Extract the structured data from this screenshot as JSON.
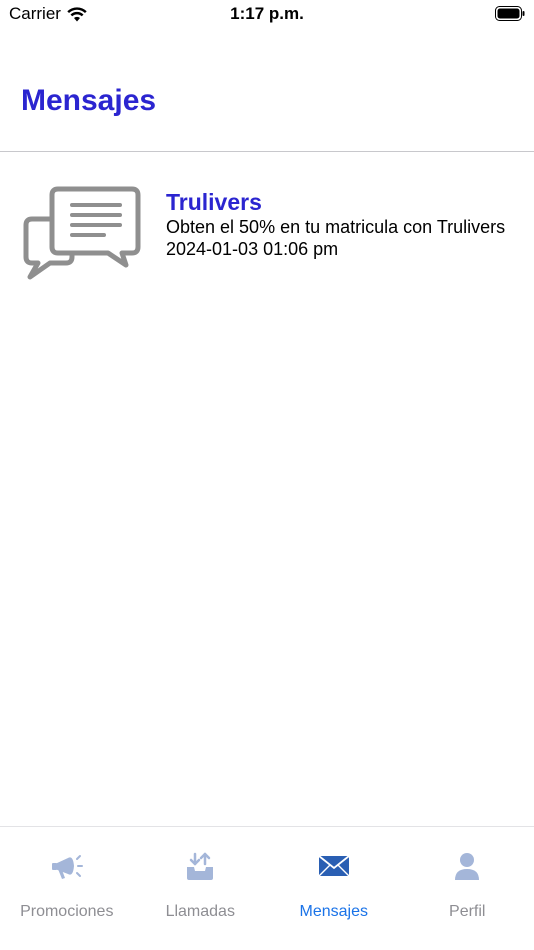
{
  "status_bar": {
    "carrier": "Carrier",
    "time": "1:17 p.m."
  },
  "header": {
    "title": "Mensajes"
  },
  "messages": [
    {
      "sender": "Trulivers",
      "body": "Obten el 50% en tu matricula con Trulivers",
      "date": "2024-01-03 01:06 pm",
      "icon": "chat-bubbles-icon"
    }
  ],
  "tab_bar": {
    "tabs": [
      {
        "label": "Promociones",
        "icon": "megaphone-icon",
        "active": false
      },
      {
        "label": "Llamadas",
        "icon": "inbox-download-icon",
        "active": false
      },
      {
        "label": "Mensajes",
        "icon": "envelope-icon",
        "active": true
      },
      {
        "label": "Perfil",
        "icon": "person-icon",
        "active": false
      }
    ]
  },
  "colors": {
    "accent": "#2b25d0",
    "tab_active": "#1a73e8",
    "tab_inactive": "#8e8e93",
    "tab_icon_inactive": "#a4b6d9"
  }
}
